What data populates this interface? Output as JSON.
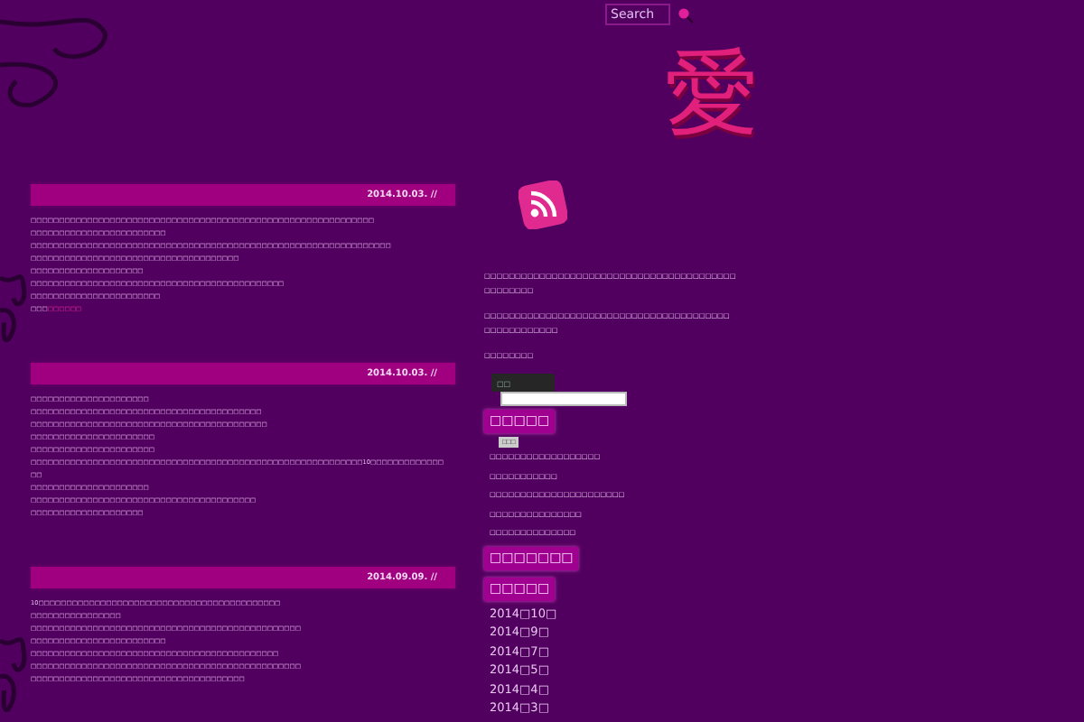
{
  "header": {
    "search": {
      "placeholder": "Search"
    },
    "logo": "愛"
  },
  "posts": [
    {
      "date": "2014.10.03. //",
      "lines": [
        "□□□□□□□□□□□□□□□□□□□□□□□□□□□□□□□□□□□□□□□□□□□□□□□□□□□□□□□□□□□□□",
        "□□□□□□□□□□□□□□□□□□□□□□□□",
        "□□□□□□□□□□□□□□□□□□□□□□□□□□□□□□□□□□□□□□□□□□□□□□□□□□□□□□□□□□□□□□□□",
        "□□□□□□□□□□□□□□□□□□□□□□□□□□□□□□□□□□□□□",
        "□□□□□□□□□□□□□□□□□□□□",
        "□□□□□□□□□□□□□□□□□□□□□□□□□□□□□□□□□□□□□□□□□□□□□",
        "□□□□□□□□□□□□□□□□□□□□□□□"
      ],
      "more_prefix": "□□□",
      "more_link": "□□□□□□"
    },
    {
      "date": "2014.10.03. //",
      "lines": [
        "□□□□□□□□□□□□□□□□□□□□□",
        "□□□□□□□□□□□□□□□□□□□□□□□□□□□□□□□□□□□□□□□□□",
        "□□□□□□□□□□□□□□□□□□□□□□□□□□□□□□□□□□□□□□□□□□",
        "□□□□□□□□□□□□□□□□□□□□□□",
        "□□□□□□□□□□□□□□□□□□□□□□",
        "□□□□□□□□□□□□□□□□□□□□□□□□□□□□□□□□□□□□□□□□□□□□□□□□□□□□□□□□□□□10□□□□□□□□□□□□□",
        "□□",
        "□□□□□□□□□□□□□□□□□□□□□",
        "□□□□□□□□□□□□□□□□□□□□□□□□□□□□□□□□□□□□□□□□",
        "□□□□□□□□□□□□□□□□□□□□"
      ]
    },
    {
      "date": "2014.09.09. //",
      "lines": [
        "10□□□□□□□□□□□□□□□□□□□□□□□□□□□□□□□□□□□□□□□□□□□",
        "□□□□□□□□□□□□□□□□",
        "□□□□□□□□□□□□□□□□□□□□□□□□□□□□□□□□□□□□□□□□□□□□□□□□",
        "□□□□□□□□□□□□□□□□□□□□□□□□",
        "□□□□□□□□□□□□□□□□□□□□□□□□□□□□□□□□□□□□□□□□□□□□",
        "□□□□□□□□□□□□□□□□□□□□□□□□□□□□□□□□□□□□□□□□□□□□□□□□",
        "□□□□□□□□□□□□□□□□□□□□□□□□□□□□□□□□□□□□□□"
      ]
    }
  ],
  "sidebar": {
    "paragraphs": [
      [
        "□□□□□□□□□□□□□□□□□□□□□□□□□□□□□□□□□□□□□□□□□",
        "□□□□□□□□"
      ],
      [
        "□□□□□□□□□□□□□□□□□□□□□□□□□□□□□□□□□□□□□□□□",
        "□□□□□□□□□□□□"
      ],
      [
        "□□□□□□□□"
      ]
    ],
    "search_label": "□□",
    "search_button": "□□□",
    "sections": [
      {
        "heading": "□□□□□",
        "links": [
          "□□□□□□□□□□□□□□□□□□",
          "□□□□□□□□□□□",
          "□□□□□□□□□□□□□□□□□□□□□□",
          "□□□□□□□□□□□□□□□",
          "□□□□□□□□□□□□□□"
        ]
      },
      {
        "heading": "□□□□□□□"
      },
      {
        "heading": "□□□□□",
        "links": [
          "2014□10□",
          "2014□9□",
          "2014□7□",
          "2014□5□",
          "2014□4□",
          "2014□3□"
        ]
      }
    ]
  }
}
